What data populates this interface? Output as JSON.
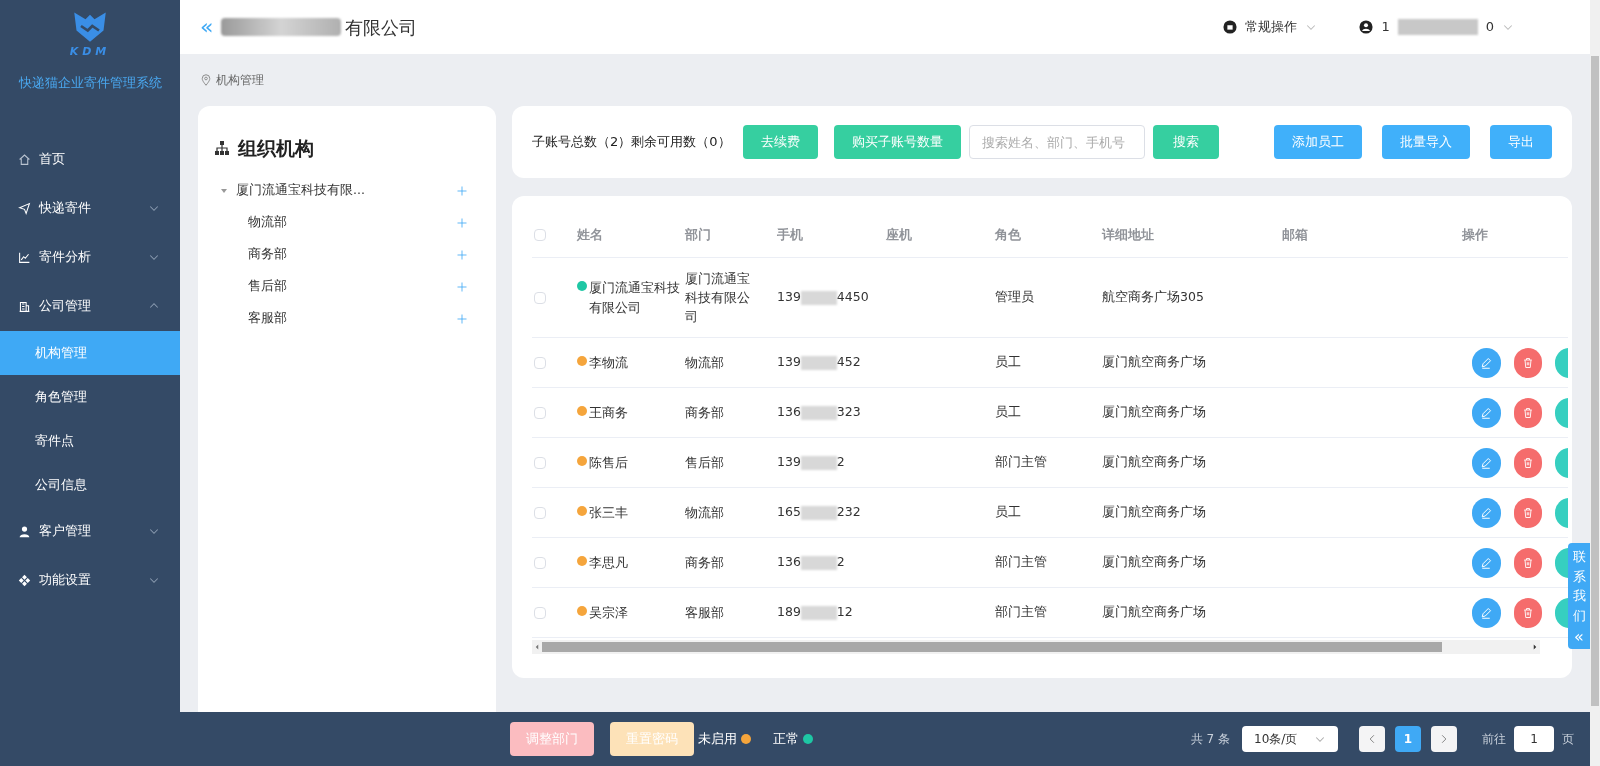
{
  "app": {
    "logo_text": "KDM",
    "title": "快递猫企业寄件管理系统"
  },
  "sidebar": {
    "items": [
      {
        "label": "首页",
        "selected": false
      },
      {
        "label": "快递寄件",
        "expanded": false,
        "selected": false
      },
      {
        "label": "寄件分析",
        "expanded": false,
        "selected": false
      },
      {
        "label": "公司管理",
        "expanded": true,
        "selected": false,
        "children": [
          {
            "label": "机构管理",
            "selected": true
          },
          {
            "label": "角色管理",
            "selected": false
          },
          {
            "label": "寄件点",
            "selected": false
          },
          {
            "label": "公司信息",
            "selected": false
          }
        ]
      },
      {
        "label": "客户管理",
        "expanded": false,
        "selected": false
      },
      {
        "label": "功能设置",
        "expanded": false,
        "selected": false
      }
    ]
  },
  "header": {
    "collapse": "«",
    "company_tail": "有限公司",
    "operations": "常规操作",
    "user_start": "1",
    "user_end": "0"
  },
  "breadcrumb": "机构管理",
  "org_tree": {
    "title": "组织机构",
    "nodes": [
      {
        "label": "厦门流通宝科技有限...",
        "expanded": true,
        "children": [
          {
            "label": "物流部"
          },
          {
            "label": "商务部"
          },
          {
            "label": "售后部"
          },
          {
            "label": "客服部"
          }
        ]
      }
    ]
  },
  "toolbar": {
    "summary": "子账号总数（2）剩余可用数（0）",
    "renew": "去续费",
    "buy": "购买子账号数量",
    "search_placeholder": "搜索姓名、部门、手机号",
    "search": "搜索",
    "add": "添加员工",
    "import": "批量导入",
    "export": "导出"
  },
  "table": {
    "all_checked": false,
    "columns": [
      "姓名",
      "部门",
      "手机",
      "座机",
      "角色",
      "详细地址",
      "邮箱",
      "操作"
    ],
    "rows": [
      {
        "checked": false,
        "color": "#1ec7a4",
        "name": "厦门流通宝科技有限公司",
        "dept": "厦门流通宝科技有限公司",
        "phone_start": "139",
        "phone_end": "4450",
        "role": "管理员",
        "address": "航空商务广场305",
        "actions": false
      },
      {
        "checked": false,
        "color": "#f5a53c",
        "name": "李物流",
        "dept": "物流部",
        "phone_start": "139",
        "phone_end": "452",
        "role": "员工",
        "address": "厦门航空商务广场",
        "actions": true
      },
      {
        "checked": false,
        "color": "#f5a53c",
        "name": "王商务",
        "dept": "商务部",
        "phone_start": "136",
        "phone_end": "323",
        "role": "员工",
        "address": "厦门航空商务广场",
        "actions": true
      },
      {
        "checked": false,
        "color": "#f5a53c",
        "name": "陈售后",
        "dept": "售后部",
        "phone_start": "139",
        "phone_end": "2",
        "role": "部门主管",
        "address": "厦门航空商务广场",
        "actions": true
      },
      {
        "checked": false,
        "color": "#f5a53c",
        "name": "张三丰",
        "dept": "物流部",
        "phone_start": "165",
        "phone_end": "232",
        "role": "员工",
        "address": "厦门航空商务广场",
        "actions": true
      },
      {
        "checked": false,
        "color": "#f5a53c",
        "name": "李思凡",
        "dept": "商务部",
        "phone_start": "136",
        "phone_end": "2",
        "role": "部门主管",
        "address": "厦门航空商务广场",
        "actions": true
      },
      {
        "checked": false,
        "color": "#f5a53c",
        "name": "吴宗泽",
        "dept": "客服部",
        "phone_start": "189",
        "phone_end": "12",
        "role": "部门主管",
        "address": "厦门航空商务广场",
        "actions": true
      }
    ]
  },
  "footer": {
    "adjust": "调整部门",
    "reset": "重置密码",
    "legend": [
      {
        "label": "未启用",
        "color": "#f5a53c"
      },
      {
        "label": "正常",
        "color": "#1ec7a4"
      }
    ],
    "total": "共 7 条",
    "page_size": "10条/页",
    "pages": [
      {
        "label": "1",
        "selected": true
      }
    ],
    "goto": "前往",
    "goto_value": "1",
    "page_unit": "页"
  },
  "contact": {
    "label": "联系我们",
    "arrow": "«"
  }
}
